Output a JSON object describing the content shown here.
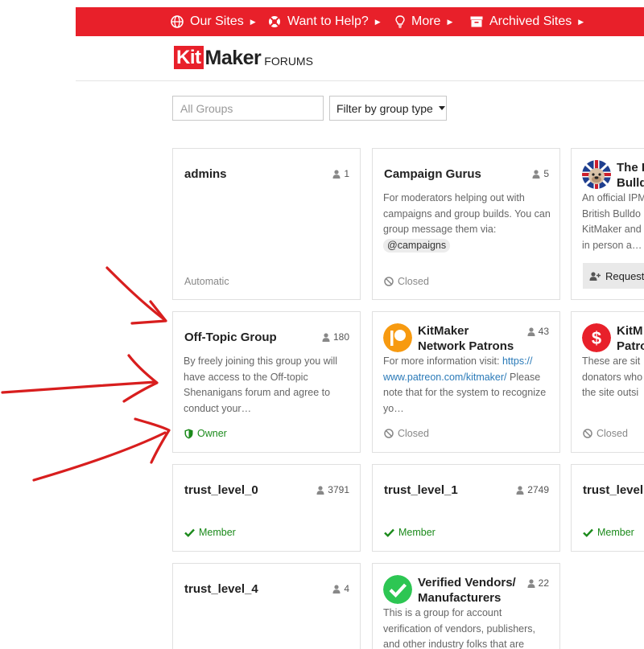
{
  "topnav": {
    "items": [
      {
        "label": "Our Sites",
        "icon": "globe-icon"
      },
      {
        "label": "Want to Help?",
        "icon": "lifebuoy-icon"
      },
      {
        "label": "More",
        "icon": "lightbulb-icon"
      },
      {
        "label": "Archived Sites",
        "icon": "archive-icon"
      }
    ]
  },
  "header": {
    "logo_kit": "Kit",
    "logo_maker": "Maker",
    "logo_forums": "FORUMS"
  },
  "filters": {
    "search_placeholder": "All Groups",
    "group_type_label": "Filter by group type"
  },
  "colors": {
    "brand_red": "#e8202a",
    "member_green": "#1b8a1b",
    "link_blue": "#2a7ab8"
  },
  "groups": [
    {
      "name": "admins",
      "count": "1",
      "status": "Automatic"
    },
    {
      "name": "Campaign Gurus",
      "count": "5",
      "desc": "For moderators helping out with campaigns and group builds. You can group message them via:",
      "tag": "@campaigns",
      "status": "Closed"
    },
    {
      "name": "The I... Bulldo...",
      "name_line1": "The I",
      "name_line2": "Bulldo",
      "desc": "An official IPM... British Bulldo... KitMaker and... in person a...",
      "desc_lines": [
        "An official IPM",
        "British Bulldo",
        "KitMaker and",
        "in person a…"
      ],
      "button": "Request"
    },
    {
      "name": "Off-Topic Group",
      "count": "180",
      "desc": "By freely joining this group you will have access to the Off-topic Shenanigans forum and agree to conduct your…",
      "status": "Owner"
    },
    {
      "name_line1": "KitMaker",
      "name_line2": "Network Patrons",
      "count": "43",
      "desc_pre": "For more information visit:",
      "desc_link": "https:// www.patreon.com/kitmaker/",
      "desc_post": "Please note that for the system to recognize yo…",
      "status": "Closed"
    },
    {
      "name_line1": "KitM",
      "name_line2": "Patro",
      "desc_lines": [
        "These are sit",
        "donators who",
        "the site outsi"
      ],
      "status": "Closed"
    },
    {
      "name": "trust_level_0",
      "count": "3791",
      "status": "Member"
    },
    {
      "name": "trust_level_1",
      "count": "2749",
      "status": "Member"
    },
    {
      "name": "trust_level",
      "status": "Member"
    },
    {
      "name": "trust_level_4",
      "count": "4"
    },
    {
      "name_line1": "Verified Vendors/",
      "name_line2": "Manufacturers",
      "count": "22",
      "desc": "This is a group for account verification of vendors, publishers, and other industry folks that are"
    }
  ]
}
